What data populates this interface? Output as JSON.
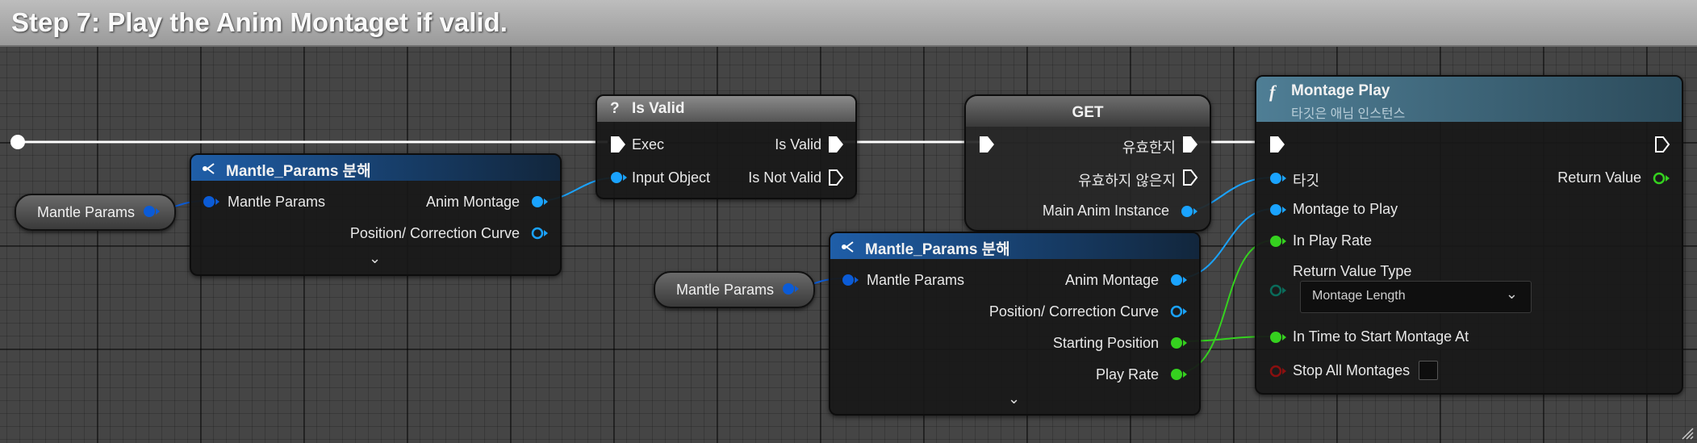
{
  "comment": {
    "title": "Step 7: Play the Anim Montaget if valid."
  },
  "break_node_1": {
    "title": "Mantle_Params 분해",
    "input": "Mantle Params",
    "outputs": [
      "Anim Montage",
      "Position/ Correction Curve"
    ],
    "expand_icon": "chevron-down-icon"
  },
  "var_node_1": {
    "label": "Mantle Params"
  },
  "is_valid_node": {
    "icon": "?",
    "title": "Is Valid",
    "inputs": [
      "Exec",
      "Input Object"
    ],
    "outputs": [
      "Is Valid",
      "Is Not Valid"
    ]
  },
  "get_node": {
    "title": "GET",
    "outputs": [
      "유효한지",
      "유효하지 않은지",
      "Main Anim Instance"
    ]
  },
  "var_node_2": {
    "label": "Mantle Params"
  },
  "break_node_2": {
    "title": "Mantle_Params 분해",
    "input": "Mantle Params",
    "outputs": [
      "Anim Montage",
      "Position/ Correction Curve",
      "Starting Position",
      "Play Rate"
    ],
    "expand_icon": "chevron-down-icon"
  },
  "montage_play_node": {
    "icon": "f",
    "title": "Montage Play",
    "subtitle": "타깃은 애님 인스턴스",
    "inputs": [
      "타깃",
      "Montage to Play",
      "In Play Rate",
      "Return Value Type",
      "In Time to Start Montage At",
      "Stop All Montages"
    ],
    "return_value_type_selected": "Montage Length",
    "outputs": [
      "Return Value"
    ]
  },
  "colors": {
    "exec": "#ffffff",
    "object_pin": "#1aa3ff",
    "struct_pin": "#0b5bd6",
    "float_pin": "#35d11f",
    "byte_pin": "#0a6b5a",
    "bool_pin": "#8a0f0f",
    "break_header": "#1f5ea8",
    "function_header": "#4f7e95"
  }
}
